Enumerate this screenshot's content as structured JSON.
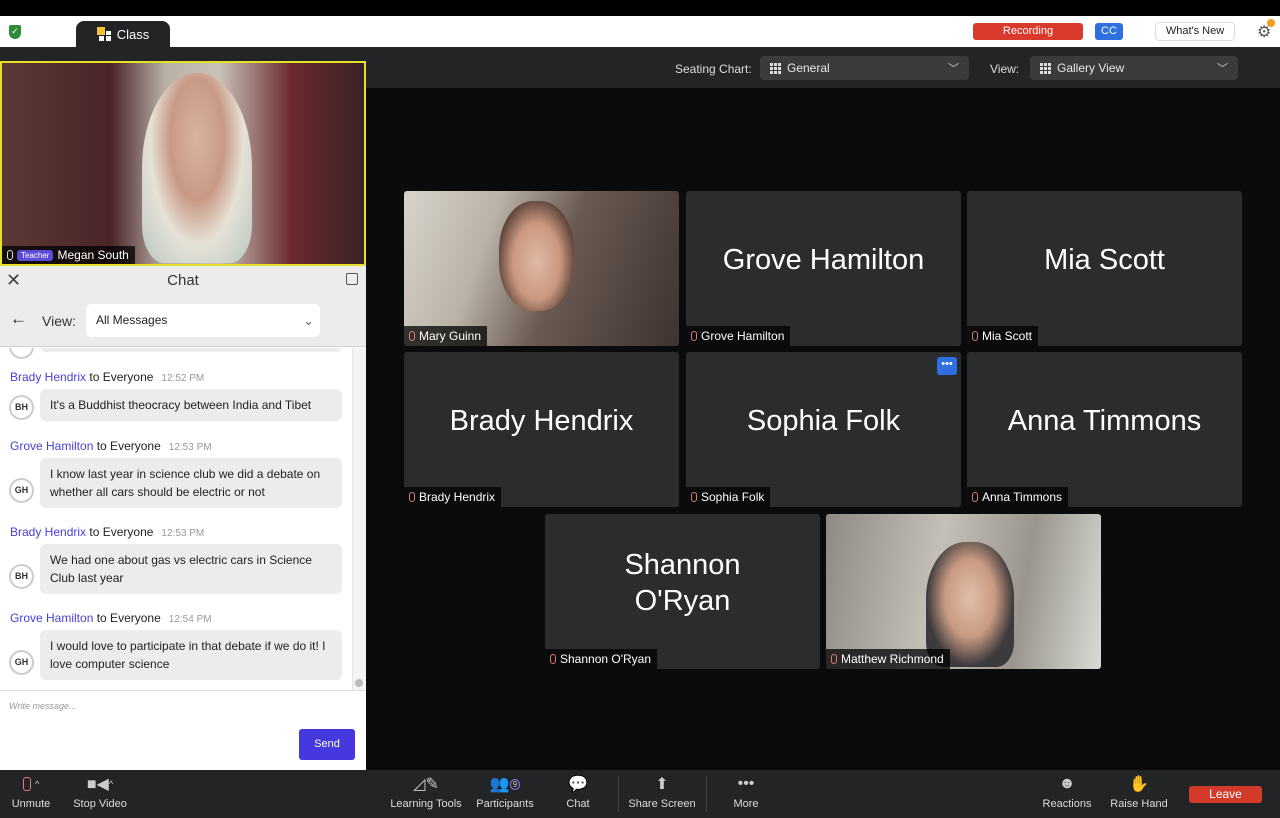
{
  "titlebar": {
    "tab": "Class",
    "recording": "Recording",
    "cc": "CC",
    "whats_new": "What's New"
  },
  "toolbar_top": {
    "seating_label": "Seating Chart:",
    "seating_value": "General",
    "view_label": "View:",
    "view_value": "Gallery View"
  },
  "teacher": {
    "badge": "Teacher",
    "name": "Megan South"
  },
  "chat": {
    "title": "Chat",
    "view_label": "View:",
    "view_value": "All Messages",
    "placeholder": "Write message...",
    "send": "Send",
    "messages": [
      {
        "from": "Brady Hendrix",
        "to": "to Everyone",
        "time": "12:52 PM",
        "initials": "BH",
        "text": "It's a Buddhist theocracy between India and Tibet"
      },
      {
        "from": "Grove Hamilton",
        "to": "to Everyone",
        "time": "12:53 PM",
        "initials": "GH",
        "text": "I know last year in science club we did a debate on whether all cars should be electric or not"
      },
      {
        "from": "Brady Hendrix",
        "to": "to Everyone",
        "time": "12:53 PM",
        "initials": "BH",
        "text": "We had one about gas vs electric cars in Science Club last year"
      },
      {
        "from": "Grove Hamilton",
        "to": "to Everyone",
        "time": "12:54 PM",
        "initials": "GH",
        "text": "I would love to participate in that debate if we do it! I love computer science"
      }
    ]
  },
  "tiles": [
    {
      "name": "Mary Guinn",
      "video": true
    },
    {
      "name": "Grove Hamilton",
      "display": "Grove Hamilton"
    },
    {
      "name": "Mia Scott",
      "display": "Mia Scott"
    },
    {
      "name": "Brady Hendrix",
      "display": "Brady Hendrix"
    },
    {
      "name": "Sophia Folk",
      "display": "Sophia Folk",
      "more": "•••"
    },
    {
      "name": "Anna Timmons",
      "display": "Anna Timmons"
    },
    {
      "name": "Shannon O'Ryan",
      "display": "Shannon O'Ryan"
    },
    {
      "name": "Matthew Richmond",
      "video": true
    }
  ],
  "bottom": {
    "unmute": "Unmute",
    "stop_video": "Stop Video",
    "learning_tools": "Learning Tools",
    "participants": "Participants",
    "participants_count": "9",
    "chat": "Chat",
    "share_screen": "Share Screen",
    "more": "More",
    "reactions": "Reactions",
    "raise_hand": "Raise Hand",
    "leave": "Leave"
  }
}
